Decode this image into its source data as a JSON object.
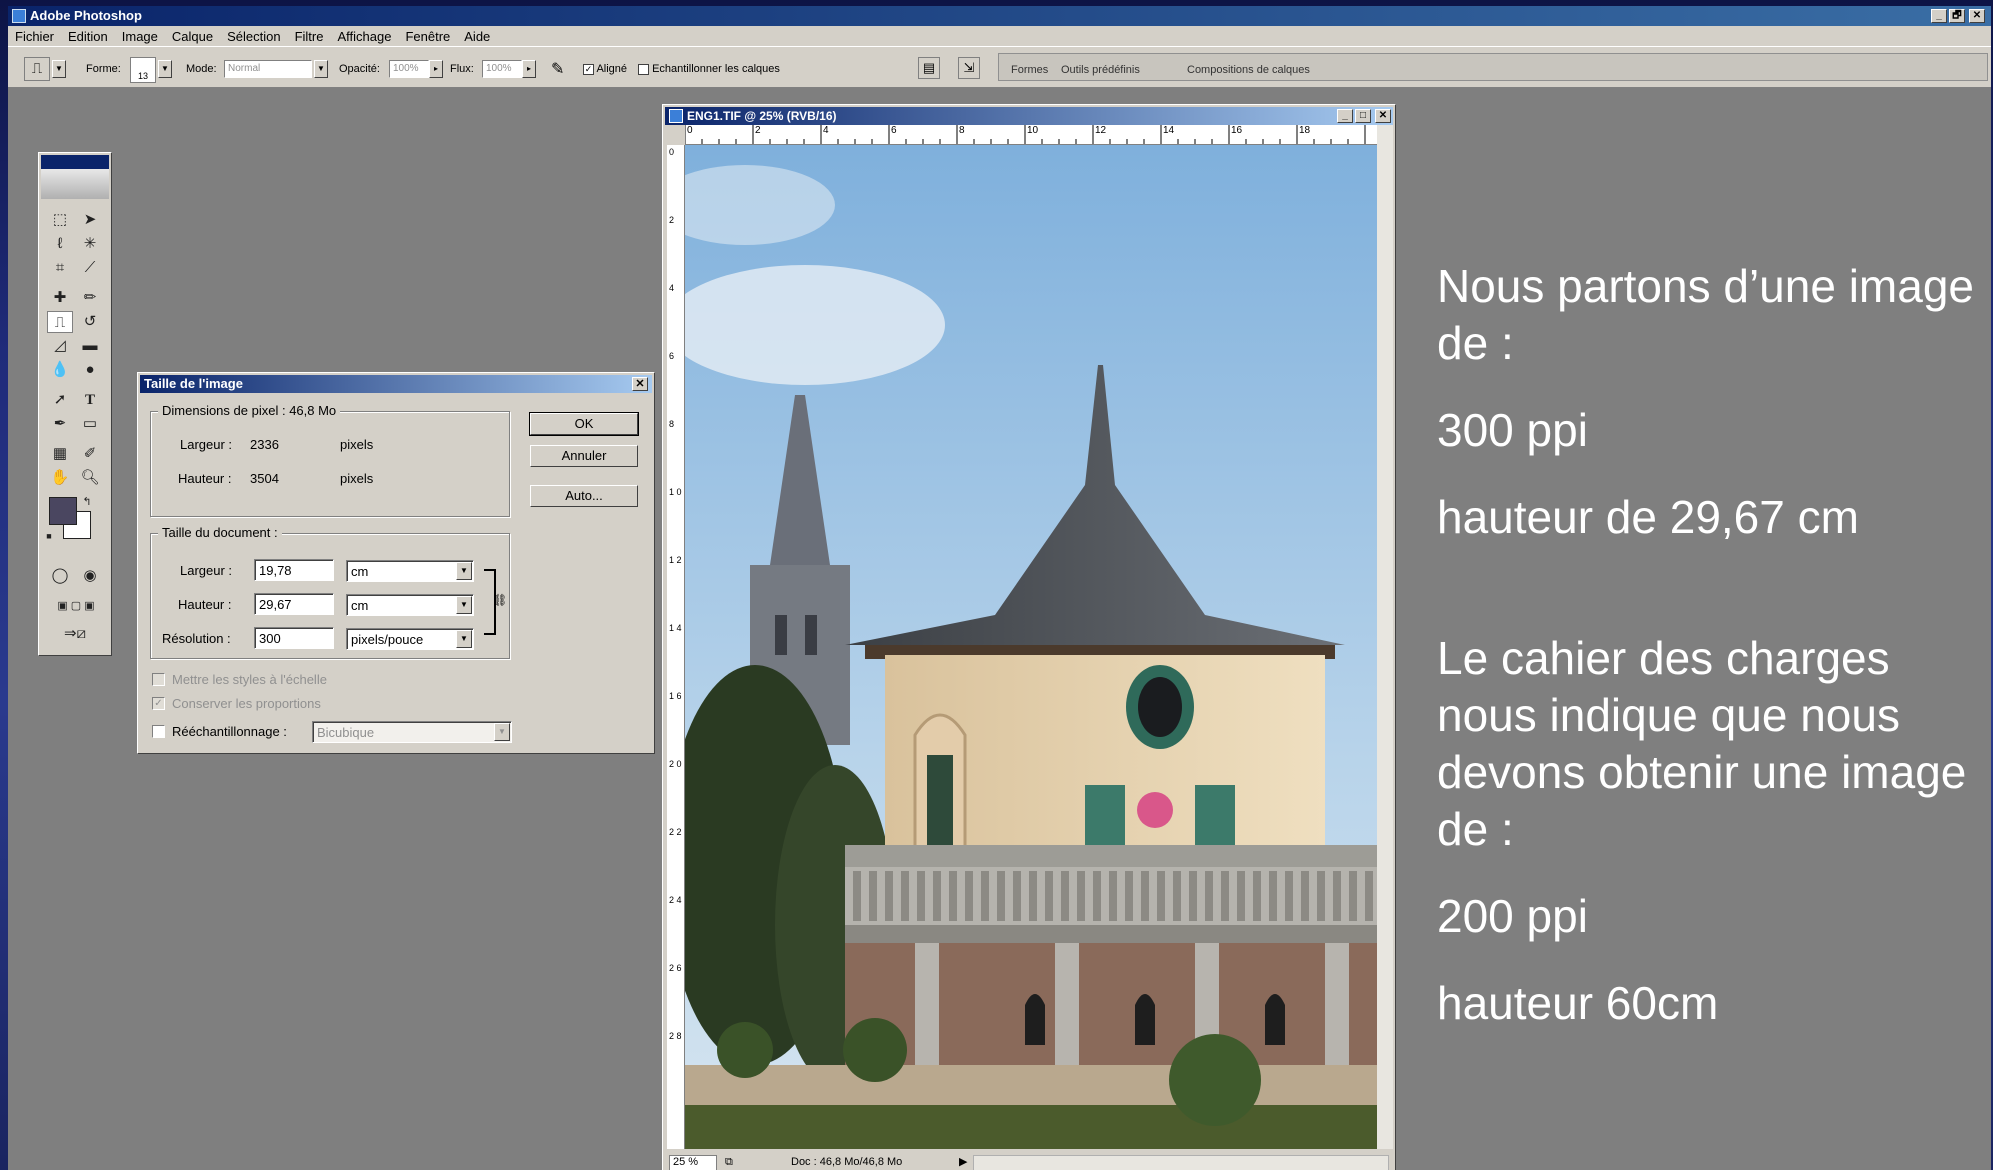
{
  "app": {
    "title": "Adobe Photoshop",
    "window_buttons": [
      "_",
      "🗗",
      "✕"
    ]
  },
  "menu": [
    "Fichier",
    "Edition",
    "Image",
    "Calque",
    "Sélection",
    "Filtre",
    "Affichage",
    "Fenêtre",
    "Aide"
  ],
  "options_bar": {
    "forme_label": "Forme:",
    "brush_size": "13",
    "mode_label": "Mode:",
    "mode_value": "Normal",
    "opacite_label": "Opacité:",
    "opacite_value": "100%",
    "flux_label": "Flux:",
    "flux_value": "100%",
    "aligne_label": "Aligné",
    "echantillonner_label": "Echantillonner les calques",
    "palette_tabs": [
      "Formes",
      "Outils prédéfinis",
      "Compositions de calques"
    ]
  },
  "dialog": {
    "title": "Taille de l'image",
    "pixel_dims_label": "Dimensions de pixel :",
    "pixel_dims_value": "46,8 Mo",
    "px_width_label": "Largeur :",
    "px_width_value": "2336",
    "px_width_unit": "pixels",
    "px_height_label": "Hauteur :",
    "px_height_value": "3504",
    "px_height_unit": "pixels",
    "doc_size_label": "Taille du document :",
    "doc_width_label": "Largeur :",
    "doc_width_value": "19,78",
    "doc_width_unit": "cm",
    "doc_height_label": "Hauteur :",
    "doc_height_value": "29,67",
    "doc_height_unit": "cm",
    "resolution_label": "Résolution :",
    "resolution_value": "300",
    "resolution_unit": "pixels/pouce",
    "scale_styles_label": "Mettre les styles à l'échelle",
    "constrain_label": "Conserver les proportions",
    "resample_label": "Rééchantillonnage :",
    "resample_value": "Bicubique",
    "ok_label": "OK",
    "cancel_label": "Annuler",
    "auto_label": "Auto..."
  },
  "document": {
    "title": "ENG1.TIF @ 25% (RVB/16)",
    "ruler_h": [
      "0",
      "2",
      "4",
      "6",
      "8",
      "10",
      "12",
      "14",
      "16",
      "18"
    ],
    "ruler_v": [
      "0",
      "2",
      "4",
      "6",
      "8",
      "1 0",
      "1 2",
      "1 4",
      "1 6",
      "2 0",
      "2 2",
      "2 4",
      "2 6",
      "2 8"
    ],
    "zoom": "25 %",
    "doc_info": "Doc : 46,8 Mo/46,8 Mo"
  },
  "notes": {
    "line1": "Nous partons d’une image de :",
    "line2": "300 ppi",
    "line3": "hauteur de 29,67 cm",
    "line4": "Le cahier des charges nous indique que nous devons obtenir une image de :",
    "line5": "200 ppi",
    "line6": "hauteur 60cm"
  }
}
